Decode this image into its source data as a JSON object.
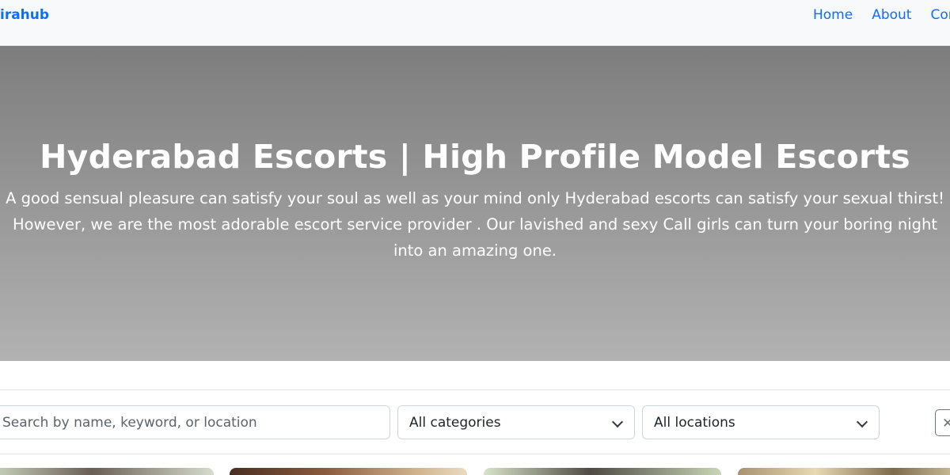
{
  "nav": {
    "brand": "irahub",
    "links": [
      "Home",
      "About",
      "Cor"
    ]
  },
  "hero": {
    "title": "Hyderabad Escorts | High Profile Model Escorts",
    "description": "A good sensual pleasure can satisfy your soul as well as your mind only Hyderabad escorts can satisfy your sexual thirst! However, we are the most adorable escort service provider . Our lavished and sexy Call girls can turn your boring night into an amazing one."
  },
  "filters": {
    "search_placeholder": "Search by name, keyword, or location",
    "category": "All categories",
    "location": "All locations",
    "clear_icon": "close-icon",
    "clear_label": "✕"
  },
  "colors": {
    "link": "#0d6efd",
    "hero_top": "#7d7d7d",
    "hero_bottom": "#b2b2b2"
  }
}
